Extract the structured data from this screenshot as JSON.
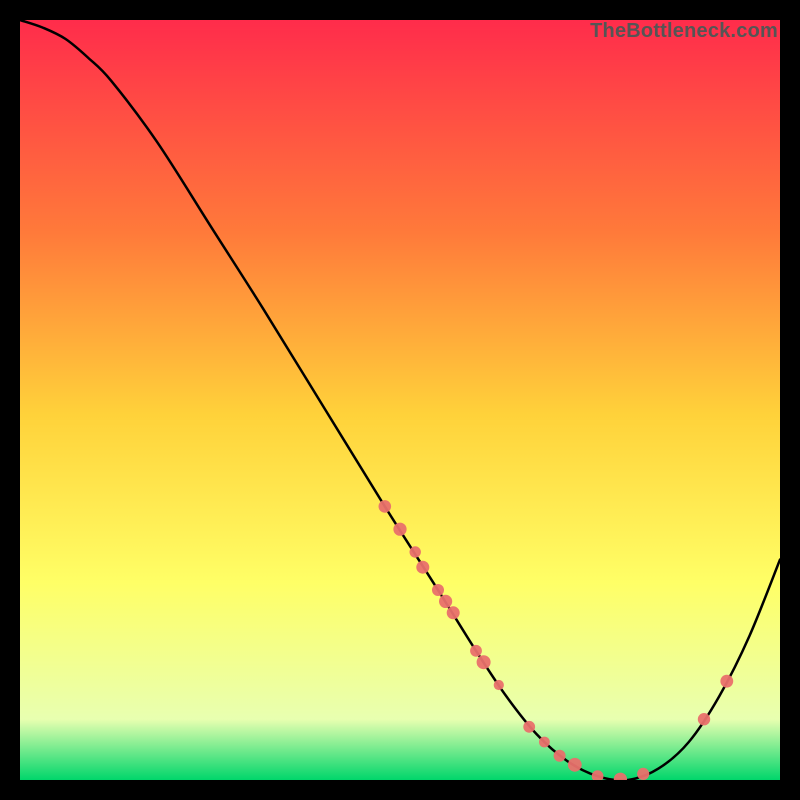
{
  "watermark": "TheBottleneck.com",
  "colors": {
    "gradient_top": "#ff2c4b",
    "gradient_mid1": "#ff7a3a",
    "gradient_mid2": "#ffd23a",
    "gradient_mid3": "#ffff66",
    "gradient_mid4": "#e8ffb0",
    "gradient_bottom": "#00d66b",
    "curve": "#000000",
    "marker_fill": "#e9706c",
    "marker_stroke": "#d95c58",
    "frame": "#000000"
  },
  "chart_data": {
    "type": "line",
    "title": "",
    "xlabel": "",
    "ylabel": "",
    "xlim": [
      0,
      100
    ],
    "ylim": [
      0,
      100
    ],
    "series": [
      {
        "name": "bottleneck-curve",
        "x": [
          0,
          3,
          6,
          9,
          12,
          18,
          25,
          32,
          40,
          48,
          55,
          60,
          64,
          68,
          72,
          76,
          80,
          84,
          88,
          92,
          96,
          100
        ],
        "y": [
          100,
          99,
          97.5,
          95,
          92,
          84,
          73,
          62,
          49,
          36,
          25,
          17,
          11,
          6,
          2.5,
          0.5,
          0,
          1.5,
          5,
          11,
          19,
          29
        ]
      }
    ],
    "markers": {
      "name": "highlighted-points",
      "x": [
        48,
        50,
        52,
        53,
        55,
        56,
        57,
        60,
        61,
        63,
        67,
        69,
        71,
        73,
        76,
        79,
        82,
        90,
        93
      ],
      "y": [
        36,
        33,
        30,
        28,
        25,
        23.5,
        22,
        17,
        15.5,
        12.5,
        7,
        5,
        3.2,
        2,
        0.5,
        0.1,
        0.8,
        8,
        13
      ]
    }
  }
}
